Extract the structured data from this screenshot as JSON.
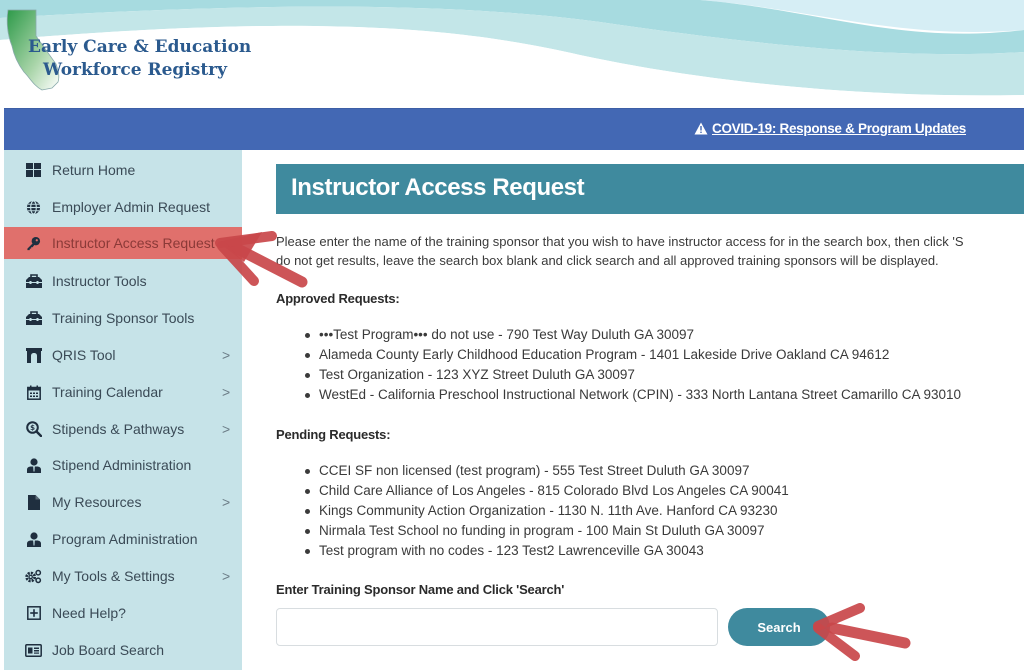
{
  "brand": {
    "line1": "Early Care & Education",
    "line2": "Workforce Registry"
  },
  "alert": {
    "icon": "warning-triangle-icon",
    "label": "COVID-19: Response & Program Updates"
  },
  "colors": {
    "alert_bar": "#4368b4",
    "sidebar_bg": "#c6e3e8",
    "active_item": "#e0706c",
    "title_bar": "#3f8a9e",
    "search_button": "#3f8a9e",
    "annotation_arrow": "#c9474a"
  },
  "sidebar": {
    "items": [
      {
        "label": "Return Home",
        "icon": "grid-icon",
        "has_submenu": false
      },
      {
        "label": "Employer Admin Request",
        "icon": "globe-icon",
        "has_submenu": false
      },
      {
        "label": "Instructor Access Request",
        "icon": "key-icon",
        "has_submenu": false,
        "active": true
      },
      {
        "label": "Instructor Tools",
        "icon": "toolbox-icon",
        "has_submenu": false
      },
      {
        "label": "Training Sponsor Tools",
        "icon": "toolbox-icon",
        "has_submenu": false
      },
      {
        "label": "QRIS Tool",
        "icon": "archway-icon",
        "has_submenu": true
      },
      {
        "label": "Training Calendar",
        "icon": "calendar-icon",
        "has_submenu": true
      },
      {
        "label": "Stipends & Pathways",
        "icon": "search-dollar-icon",
        "has_submenu": true
      },
      {
        "label": "Stipend Administration",
        "icon": "user-tie-icon",
        "has_submenu": false
      },
      {
        "label": "My Resources",
        "icon": "file-icon",
        "has_submenu": true
      },
      {
        "label": "Program Administration",
        "icon": "user-tie-icon",
        "has_submenu": false
      },
      {
        "label": "My Tools & Settings",
        "icon": "cogs-icon",
        "has_submenu": true
      },
      {
        "label": "Need Help?",
        "icon": "plus-square-icon",
        "has_submenu": false
      },
      {
        "label": "Job Board Search",
        "icon": "id-card-icon",
        "has_submenu": false
      }
    ],
    "chevron": ">"
  },
  "main": {
    "title": "Instructor Access Request",
    "intro_line1": "Please enter the name of the training sponsor that you wish to have instructor access for in the search box, then click 'S",
    "intro_line2": "do not get results, leave the search box blank and click search and all approved training sponsors will be displayed.",
    "approved_heading": "Approved Requests:",
    "approved": [
      "•••Test Program••• do not use - 790 Test Way Duluth GA 30097",
      "Alameda County Early Childhood Education Program - 1401 Lakeside Drive Oakland CA 94612",
      "Test Organization - 123 XYZ Street Duluth GA 30097",
      "WestEd - California Preschool Instructional Network (CPIN) - 333 North Lantana Street Camarillo CA 93010"
    ],
    "pending_heading": "Pending Requests:",
    "pending": [
      "CCEI SF non licensed (test program) - 555 Test Street Duluth GA 30097",
      "Child Care Alliance of Los Angeles - 815 Colorado Blvd Los Angeles CA 90041",
      "Kings Community Action Organization - 1130 N. 11th Ave. Hanford CA 93230",
      "Nirmala Test School no funding in program - 100 Main St Duluth GA 30097",
      "Test program with no codes - 123 Test2 Lawrenceville GA 30043"
    ],
    "search_label": "Enter Training Sponsor Name and Click 'Search'",
    "search_value": "",
    "search_placeholder": "",
    "search_button": "Search"
  }
}
